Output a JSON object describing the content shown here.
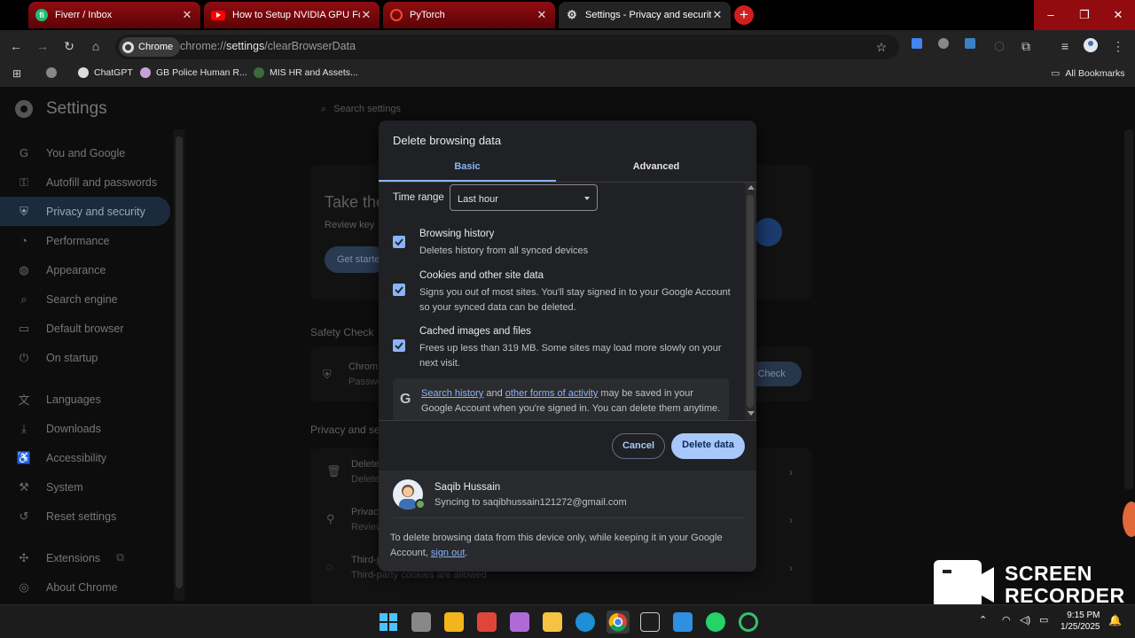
{
  "tabs": [
    {
      "title": "Fiverr / Inbox",
      "icon": "fiverr-icon",
      "active": false
    },
    {
      "title": "How to Setup NVIDIA GPU For PyTorch",
      "icon": "youtube-icon",
      "active": false
    },
    {
      "title": "PyTorch",
      "icon": "pytorch-icon",
      "active": false
    },
    {
      "title": "Settings - Privacy and security",
      "icon": "gear-icon",
      "active": true
    }
  ],
  "toolbar": {
    "chip_label": "Chrome",
    "url_prefix": "chrome://",
    "url_host": "settings",
    "url_path": "/clearBrowserData"
  },
  "bookmarks": {
    "items": [
      "ChatGPT",
      "GB Police Human R...",
      "MIS HR and Assets..."
    ],
    "all_label": "All Bookmarks"
  },
  "settings": {
    "title": "Settings",
    "search_placeholder": "Search settings",
    "nav": [
      {
        "label": "You and Google",
        "icon": "google-icon"
      },
      {
        "label": "Autofill and passwords",
        "icon": "key-icon"
      },
      {
        "label": "Privacy and security",
        "icon": "shield-icon"
      },
      {
        "label": "Performance",
        "icon": "gauge-icon"
      },
      {
        "label": "Appearance",
        "icon": "palette-icon"
      },
      {
        "label": "Search engine",
        "icon": "search-icon"
      },
      {
        "label": "Default browser",
        "icon": "browser-icon"
      },
      {
        "label": "On startup",
        "icon": "power-icon"
      },
      {
        "label": "Languages",
        "icon": "translate-icon"
      },
      {
        "label": "Downloads",
        "icon": "download-icon"
      },
      {
        "label": "Accessibility",
        "icon": "accessibility-icon"
      },
      {
        "label": "System",
        "icon": "wrench-icon"
      },
      {
        "label": "Reset settings",
        "icon": "reset-icon"
      },
      {
        "label": "Extensions",
        "icon": "puzzle-icon"
      },
      {
        "label": "About Chrome",
        "icon": "chrome-icon"
      }
    ],
    "bg": {
      "take_the": "Take the",
      "review_key": "Review key",
      "get_started": "Get starte",
      "safety_check": "Safety Check",
      "chrome_label": "Chrom",
      "passwo": "Passwo",
      "safety_btn": "y Check",
      "privacy_heading": "Privacy and se",
      "row1_a": "Delete",
      "row1_b": "Delete",
      "row2_a": "Privacy",
      "row2_b": "Review",
      "row3_a": "Third-p",
      "row3_b": "Third-party cookies are allowed"
    }
  },
  "dialog": {
    "title": "Delete browsing data",
    "tab_basic": "Basic",
    "tab_advanced": "Advanced",
    "time_range_label": "Time range",
    "time_range_value": "Last hour",
    "options": [
      {
        "title": "Browsing history",
        "desc": "Deletes history from all synced devices",
        "checked": true
      },
      {
        "title": "Cookies and other site data",
        "desc": "Signs you out of most sites. You'll stay signed in to your Google Account so your synced data can be deleted.",
        "checked": true
      },
      {
        "title": "Cached images and files",
        "desc": "Frees up less than 319 MB. Some sites may load more slowly on your next visit.",
        "checked": true
      }
    ],
    "google_note": {
      "link1": "Search history",
      "and": "and",
      "link2": "other forms of activity",
      "rest": "may be saved in your Google Account when you're signed in. You can delete them anytime."
    },
    "cancel_label": "Cancel",
    "delete_label": "Delete data",
    "account_name": "Saqib Hussain",
    "account_sync": "Syncing to saqibhussain121272@gmail.com",
    "footer_text": "To delete browsing data from this device only, while keeping it in your Google Account,",
    "sign_out": "sign out",
    "footer_end": "."
  },
  "taskbar": {
    "time": "9:15 PM",
    "date": "1/25/2025"
  },
  "watermark": {
    "line1": "SCREEN",
    "line2": "RECORDER"
  },
  "colors": {
    "accent": "#8ab4f8",
    "tab_red": "#8e0d12",
    "dialog_bg": "#202124",
    "delete_button": "#a8c7fa"
  }
}
